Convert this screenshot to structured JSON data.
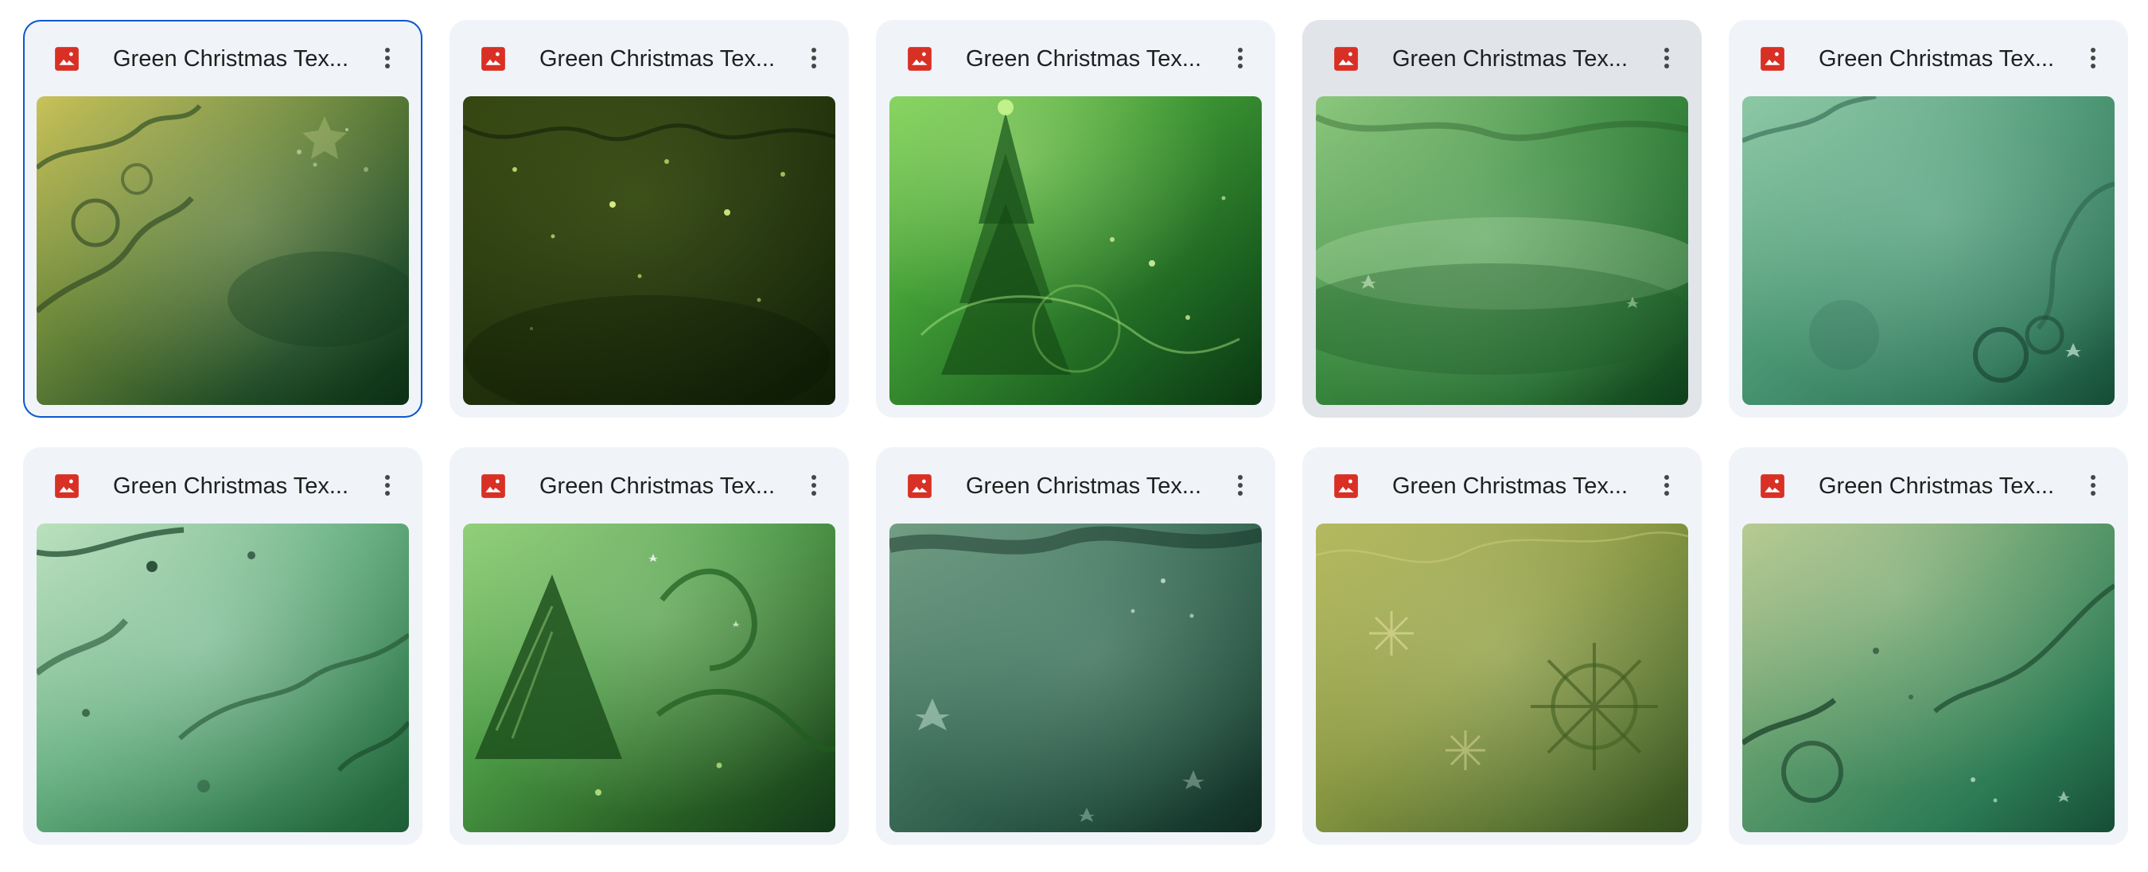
{
  "files": [
    {
      "title": "Green Christmas Tex...",
      "state": "selected",
      "icon": "image-file-icon",
      "menu_icon": "more-vert-icon",
      "palette": [
        "#c9c25a",
        "#6f8a3b",
        "#1e4a24",
        "#0c2f16"
      ]
    },
    {
      "title": "Green Christmas Tex...",
      "state": "normal",
      "icon": "image-file-icon",
      "menu_icon": "more-vert-icon",
      "palette": [
        "#31420f",
        "#24340c",
        "#172709",
        "#0f1d06"
      ]
    },
    {
      "title": "Green Christmas Tex...",
      "state": "normal",
      "icon": "image-file-icon",
      "menu_icon": "more-vert-icon",
      "palette": [
        "#7fd15a",
        "#3f9a34",
        "#1a5f20",
        "#0b3612"
      ]
    },
    {
      "title": "Green Christmas Tex...",
      "state": "hovered",
      "icon": "image-file-icon",
      "menu_icon": "more-vert-icon",
      "palette": [
        "#8bc77b",
        "#3f8e43",
        "#226a2d",
        "#0f3e1b"
      ]
    },
    {
      "title": "Green Christmas Tex...",
      "state": "normal",
      "icon": "image-file-icon",
      "menu_icon": "more-vert-icon",
      "palette": [
        "#8cc8a4",
        "#4d9975",
        "#2e7658",
        "#154b36"
      ]
    },
    {
      "title": "Green Christmas Tex...",
      "state": "normal",
      "icon": "image-file-icon",
      "menu_icon": "more-vert-icon",
      "palette": [
        "#b7dfb9",
        "#67b081",
        "#2f7d4d",
        "#1e5d36"
      ]
    },
    {
      "title": "Green Christmas Tex...",
      "state": "normal",
      "icon": "image-file-icon",
      "menu_icon": "more-vert-icon",
      "palette": [
        "#8fcf77",
        "#4b9a45",
        "#285f24",
        "#123818"
      ]
    },
    {
      "title": "Green Christmas Tex...",
      "state": "normal",
      "icon": "image-file-icon",
      "menu_icon": "more-vert-icon",
      "palette": [
        "#739f85",
        "#3f705c",
        "#214c3c",
        "#102b22"
      ]
    },
    {
      "title": "Green Christmas Tex...",
      "state": "normal",
      "icon": "image-file-icon",
      "menu_icon": "more-vert-icon",
      "palette": [
        "#b4b95e",
        "#8d9a43",
        "#57722f",
        "#344f1f"
      ]
    },
    {
      "title": "Green Christmas Tex...",
      "state": "normal",
      "icon": "image-file-icon",
      "menu_icon": "more-vert-icon",
      "palette": [
        "#b3c78e",
        "#5d9b6b",
        "#2c7b55",
        "#164d34"
      ]
    }
  ],
  "colors": {
    "card_bg": "#f0f4f9",
    "card_hover_bg": "#e1e5ea",
    "selection_border": "#0b57d0",
    "image_icon_red": "#d93025",
    "title_text": "#1f1f1f",
    "menu_icon": "#444746"
  }
}
